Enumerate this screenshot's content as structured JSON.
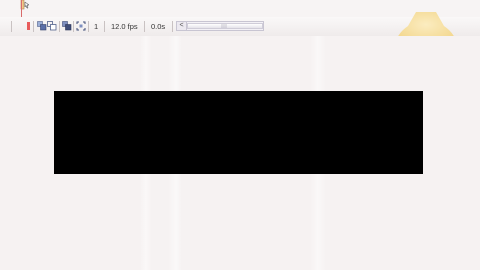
{
  "toolbar": {
    "frame_number": "1",
    "frame_rate": "12.0 fps",
    "elapsed_time": "0.0s",
    "scroll_left_glyph": "<"
  },
  "colors": {
    "playhead": "#d96a6a",
    "bulb": "#f6dc9a",
    "stage_object": "#000000"
  },
  "icons": {
    "playhead": "playhead-marker-icon",
    "center_frame": "center-frame-icon",
    "onion_skin": "onion-skin-icon",
    "onion_outline": "onion-skin-outlines-icon",
    "edit_multiple": "edit-multiple-frames-icon",
    "onion_markers": "modify-onion-markers-icon",
    "light_bulb": "light-bulb-icon"
  }
}
